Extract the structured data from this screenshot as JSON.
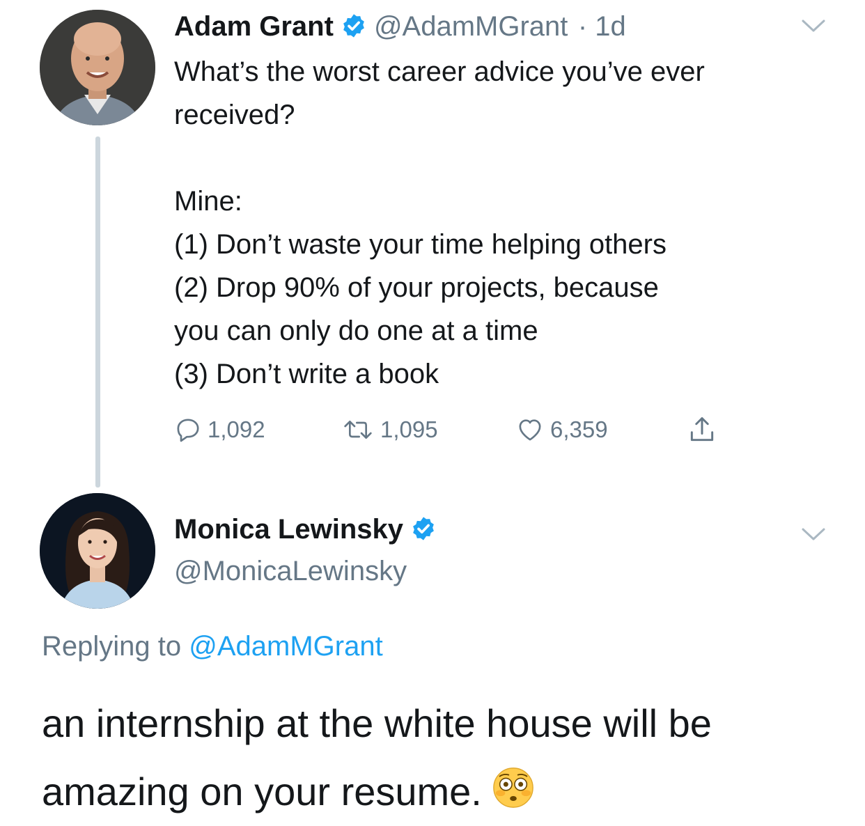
{
  "tweet": {
    "author_name": "Adam Grant",
    "author_handle": "@AdamMGrant",
    "time": "· 1d",
    "text_lines": [
      "What’s the worst career advice you’ve ever",
      "received?",
      "",
      "Mine:",
      "(1) Don’t waste your time helping others",
      "(2) Drop 90% of your projects, because",
      "you can only do one at a time",
      "(3) Don’t write a book"
    ],
    "replies": "1,092",
    "retweets": "1,095",
    "likes": "6,359"
  },
  "reply": {
    "author_name": "Monica Lewinsky",
    "author_handle": "@MonicaLewinsky",
    "replying_to_label": "Replying to",
    "replying_to_handle": "@AdamMGrant",
    "text": "an internship at the white house will be amazing on your resume."
  },
  "icons": {
    "verified": "verified-badge-icon",
    "caret": "chevron-down-icon",
    "reply": "reply-icon",
    "retweet": "retweet-icon",
    "like": "heart-icon",
    "share": "share-icon",
    "emoji": "flushed-face-emoji"
  },
  "colors": {
    "text": "#14171a",
    "secondary": "#657786",
    "accent": "#1da1f2",
    "thread_line": "#ccd6dd"
  }
}
